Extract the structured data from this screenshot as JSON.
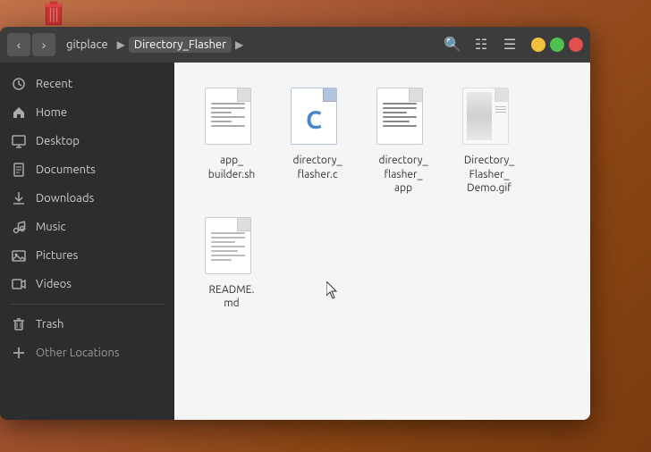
{
  "desktop": {
    "trash_label": "Trash"
  },
  "window": {
    "title": "Directory_Flasher",
    "breadcrumbs": [
      {
        "label": "gitplace",
        "active": false
      },
      {
        "label": "Directory_Flasher",
        "active": true
      }
    ],
    "window_controls": {
      "minimize": "–",
      "maximize": "□",
      "close": "✕"
    }
  },
  "toolbar": {
    "search_icon": "🔍",
    "properties_icon": "☰",
    "menu_icon": "≡"
  },
  "sidebar": {
    "items": [
      {
        "id": "recent",
        "label": "Recent",
        "icon": "🕐"
      },
      {
        "id": "home",
        "label": "Home",
        "icon": "🏠"
      },
      {
        "id": "desktop",
        "label": "Desktop",
        "icon": "🖥"
      },
      {
        "id": "documents",
        "label": "Documents",
        "icon": "📄"
      },
      {
        "id": "downloads",
        "label": "Downloads",
        "icon": "⬇"
      },
      {
        "id": "music",
        "label": "Music",
        "icon": "🎵"
      },
      {
        "id": "pictures",
        "label": "Pictures",
        "icon": "🖼"
      },
      {
        "id": "videos",
        "label": "Videos",
        "icon": "🎬"
      },
      {
        "id": "trash",
        "label": "Trash",
        "icon": "🗑"
      }
    ],
    "other_locations_label": "Other Locations",
    "other_locations_icon": "+"
  },
  "files": [
    {
      "id": "app_builder",
      "name": "app_builder.sh",
      "type": "shell",
      "display_name": "app_\nbuilder.sh"
    },
    {
      "id": "directory_flasher_c",
      "name": "directory_flasher.c",
      "type": "c",
      "display_name": "directory_\nflasher.c"
    },
    {
      "id": "directory_flasher_app",
      "name": "directory_flasher_app",
      "type": "app",
      "display_name": "directory_\nflasher_\napp"
    },
    {
      "id": "directory_flasher_demo",
      "name": "Directory_Flasher_Demo.gif",
      "type": "gif",
      "display_name": "Directory_\nFlasher_\nDemo.gif"
    },
    {
      "id": "readme",
      "name": "README.md",
      "type": "markdown",
      "display_name": "README.\nmd"
    }
  ],
  "colors": {
    "sidebar_bg": "#2d2d2d",
    "titlebar_bg": "#3c3c3c",
    "files_bg": "#f5f5f5",
    "accent": "#4a86c8"
  }
}
